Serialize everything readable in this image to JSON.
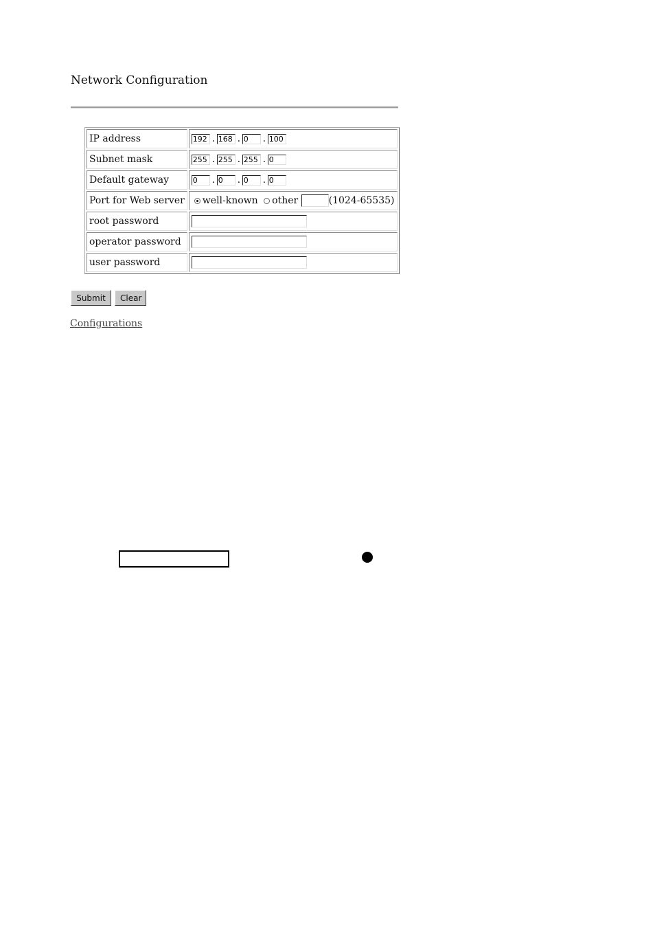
{
  "page": {
    "title": "Network Configuration"
  },
  "form": {
    "rows": [
      {
        "label": "IP address",
        "octets": [
          "192",
          "168",
          "0",
          "100"
        ]
      },
      {
        "label": "Subnet mask",
        "octets": [
          "255",
          "255",
          "255",
          "0"
        ]
      },
      {
        "label": "Default gateway",
        "octets": [
          "0",
          "0",
          "0",
          "0"
        ]
      }
    ],
    "port": {
      "label": "Port for Web server",
      "option_wellknown": "well-known",
      "option_other": "other",
      "selected": "well-known",
      "other_value": "",
      "range_hint": "(1024-65535)"
    },
    "passwords": [
      {
        "label": "root password",
        "value": ""
      },
      {
        "label": "operator password",
        "value": ""
      },
      {
        "label": "user password",
        "value": ""
      }
    ],
    "separator": "."
  },
  "buttons": {
    "submit": "Submit",
    "clear": "Clear"
  },
  "links": {
    "configurations": "Configurations"
  }
}
